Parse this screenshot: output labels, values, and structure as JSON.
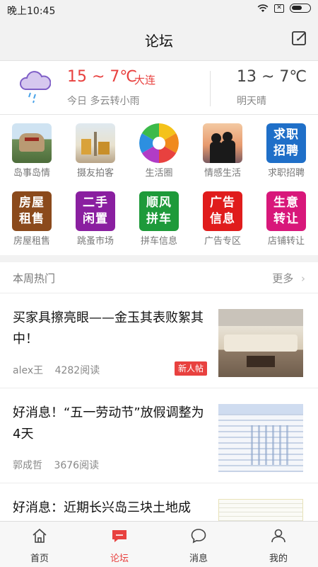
{
  "status": {
    "time": "晚上10:45",
    "sim": "✕"
  },
  "header": {
    "title": "论坛"
  },
  "weather": {
    "today_temp": "15 ~ 7℃",
    "city": "大连",
    "today_desc": "今日 多云转小雨",
    "tomorrow_temp": "13 ~ 7℃",
    "tomorrow_desc": "明天晴"
  },
  "categories": [
    {
      "label": "岛事岛情",
      "icon": "island-photo"
    },
    {
      "label": "摄友拍客",
      "icon": "camera-photo"
    },
    {
      "label": "生活圈",
      "icon": "aperture-icon"
    },
    {
      "label": "情感生活",
      "icon": "couple-photo"
    },
    {
      "label": "求职招聘",
      "tile": "求职招聘",
      "color": "#1f6fc8"
    },
    {
      "label": "房屋租售",
      "tile": "房屋租售",
      "color": "#8b4a1c"
    },
    {
      "label": "跳蚤市场",
      "tile": "二手闲置",
      "color": "#8a1fa0"
    },
    {
      "label": "拼车信息",
      "tile": "顺风拼车",
      "color": "#1e9a3a"
    },
    {
      "label": "广告专区",
      "tile": "广告信息",
      "color": "#e01c1c"
    },
    {
      "label": "店铺转让",
      "tile": "生意转让",
      "color": "#d8177a"
    }
  ],
  "hot": {
    "title": "本周热门",
    "more": "更多"
  },
  "posts": [
    {
      "title": "买家具擦亮眼——金玉其表败絮其中！",
      "author": "alex王",
      "views": "4282阅读",
      "badge": "新人帖"
    },
    {
      "title": "好消息！“五一劳动节”放假调整为4天",
      "author": "郭成哲",
      "views": "3676阅读",
      "badge": ""
    },
    {
      "title": "好消息：近期长兴岛三块土地成",
      "author": "",
      "views": "",
      "badge": ""
    }
  ],
  "tabs": [
    {
      "label": "首页",
      "icon": "home-icon"
    },
    {
      "label": "论坛",
      "icon": "forum-icon"
    },
    {
      "label": "消息",
      "icon": "message-icon"
    },
    {
      "label": "我的",
      "icon": "profile-icon"
    }
  ],
  "colors": {
    "accent": "#e8413f"
  }
}
